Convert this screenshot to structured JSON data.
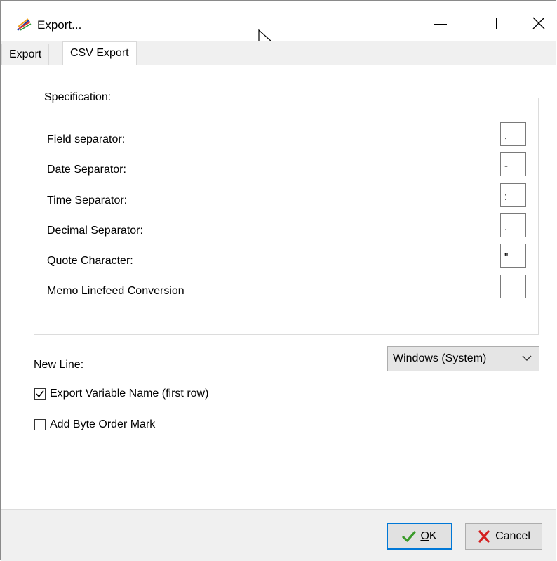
{
  "window": {
    "title": "Export..."
  },
  "tabs": [
    {
      "label": "Export",
      "active": false
    },
    {
      "label": "CSV Export",
      "active": true
    }
  ],
  "specification": {
    "title": "Specification:",
    "fields": [
      {
        "label": "Field separator:",
        "value": ","
      },
      {
        "label": "Date Separator:",
        "value": "-"
      },
      {
        "label": "Time Separator:",
        "value": ":"
      },
      {
        "label": "Decimal Separator:",
        "value": "."
      },
      {
        "label": "Quote Character:",
        "value": "\""
      },
      {
        "label": "Memo Linefeed Conversion",
        "value": ""
      }
    ]
  },
  "new_line": {
    "label": "New Line:",
    "selected": "Windows (System)"
  },
  "options": {
    "export_variable_name": {
      "label": "Export Variable Name (first row)",
      "checked": true
    },
    "add_byte_order_mark": {
      "label": "Add Byte Order Mark",
      "checked": false
    }
  },
  "buttons": {
    "ok": {
      "mnemonic": "O",
      "rest": "K"
    },
    "cancel": {
      "label": "Cancel"
    }
  },
  "icons": {
    "app": "app-feather-icon",
    "ok": "checkmark-icon",
    "cancel": "x-icon",
    "dropdown": "chevron-down-icon",
    "cursor": "mouse-pointer-icon"
  },
  "colors": {
    "ok_check": "#3a9a2a",
    "cancel_x": "#d42020",
    "focus_border": "#0078d7",
    "footer_bg": "#f0f0f0"
  }
}
